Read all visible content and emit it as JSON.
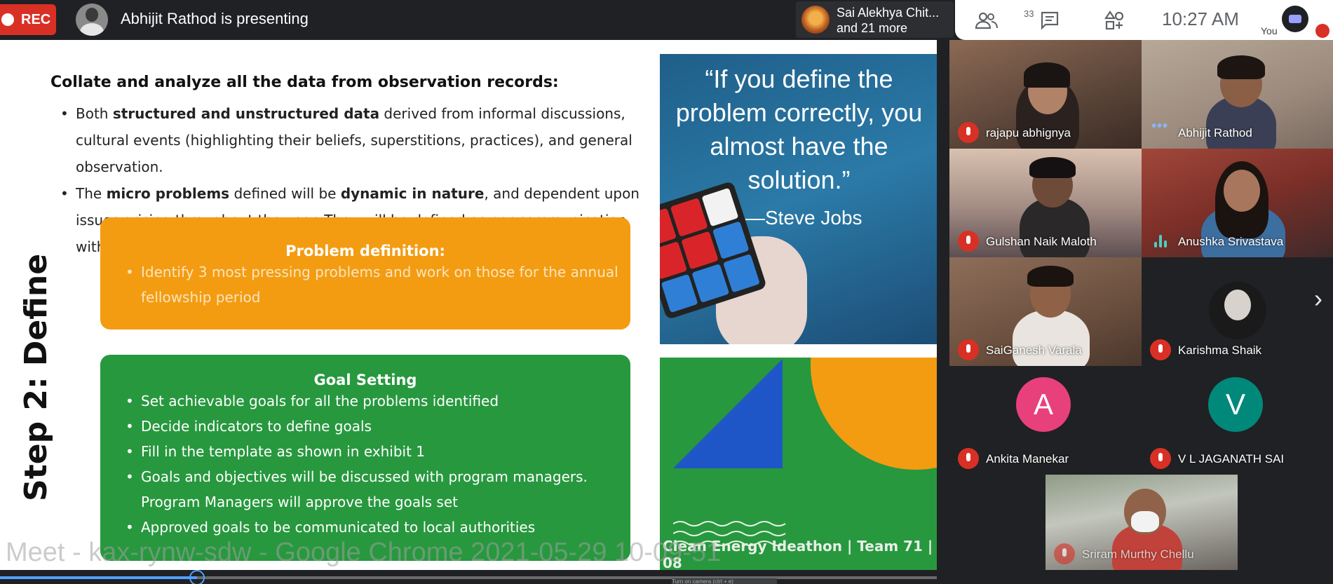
{
  "topbar": {
    "rec_label": "REC",
    "presenting_text": "Abhijit Rathod is presenting",
    "others_line1": "Sai Alekhya Chit...",
    "others_line2": "and 21 more",
    "people_count": "33",
    "time": "10:27  AM",
    "you_label": "You"
  },
  "slide": {
    "heading": "Collate and analyze all the data from observation records:",
    "bullet1_pre": "Both ",
    "bullet1_bold": "structured and unstructured data",
    "bullet1_post": " derived from informal discussions, cultural events (highlighting their beliefs, superstitions, practices), and general observation.",
    "bullet2_pre": "The ",
    "bullet2_bold1": "micro problems",
    "bullet2_mid": " defined will be ",
    "bullet2_bold2": "dynamic in nature",
    "bullet2_post": ", and dependent upon issues arising throughout the year. They will be defined as per communication with localities.",
    "step_title": "Step 2: Define",
    "problem_box": {
      "title": "Problem definition:",
      "items": [
        "Identify 3 most pressing problems and work on those for the annual fellowship period"
      ]
    },
    "goal_box": {
      "title": "Goal Setting",
      "items": [
        "Set achievable goals for all the problems identified",
        "Decide indicators to define goals",
        "Fill in the template as shown in exhibit 1",
        "Goals and objectives will be discussed with program managers. Program Managers will approve the goals set",
        "Approved goals to be communicated to local authorities"
      ]
    },
    "quote_text": "“If you define the problem correctly, you almost have the solution.”",
    "quote_author": "—Steve Jobs",
    "footer": "Clean Energy Ideathon | Team 71 | 08",
    "watermark": "Meet - kax-rynw-sdw - Google Chrome 2021-05-29 10-09-51"
  },
  "player": {
    "progress_fraction": 0.21,
    "tooltip": "Turn on camera (ctrl + e)"
  },
  "participants": [
    {
      "name": "rajapu abhignya",
      "status": "muted"
    },
    {
      "name": "Abhijit Rathod",
      "status": "presenting"
    },
    {
      "name": "Gulshan Naik Maloth",
      "status": "muted"
    },
    {
      "name": "Anushka Srivastava",
      "status": "speaking"
    },
    {
      "name": "SaiGanesh Varala",
      "status": "muted"
    },
    {
      "name": "Karishma Shaik",
      "status": "muted"
    },
    {
      "name": "Ankita Manekar",
      "status": "muted",
      "initial": "A",
      "color": "#e8407a"
    },
    {
      "name": "V L JAGANATH SAI",
      "status": "muted",
      "initial": "V",
      "color": "#00897b"
    },
    {
      "name": "Sriram Murthy Chellu",
      "status": "muted"
    }
  ],
  "colors": {
    "rec": "#d93025",
    "orange": "#f39c12",
    "green": "#27983e",
    "blue": "#1f56c7",
    "mic_off": "#d93025"
  },
  "icons": [
    "record-dot-icon",
    "people-icon",
    "chat-icon",
    "activities-icon",
    "mic-off-icon",
    "chevron-right-icon",
    "more-dots-icon",
    "speaking-wave-icon"
  ]
}
